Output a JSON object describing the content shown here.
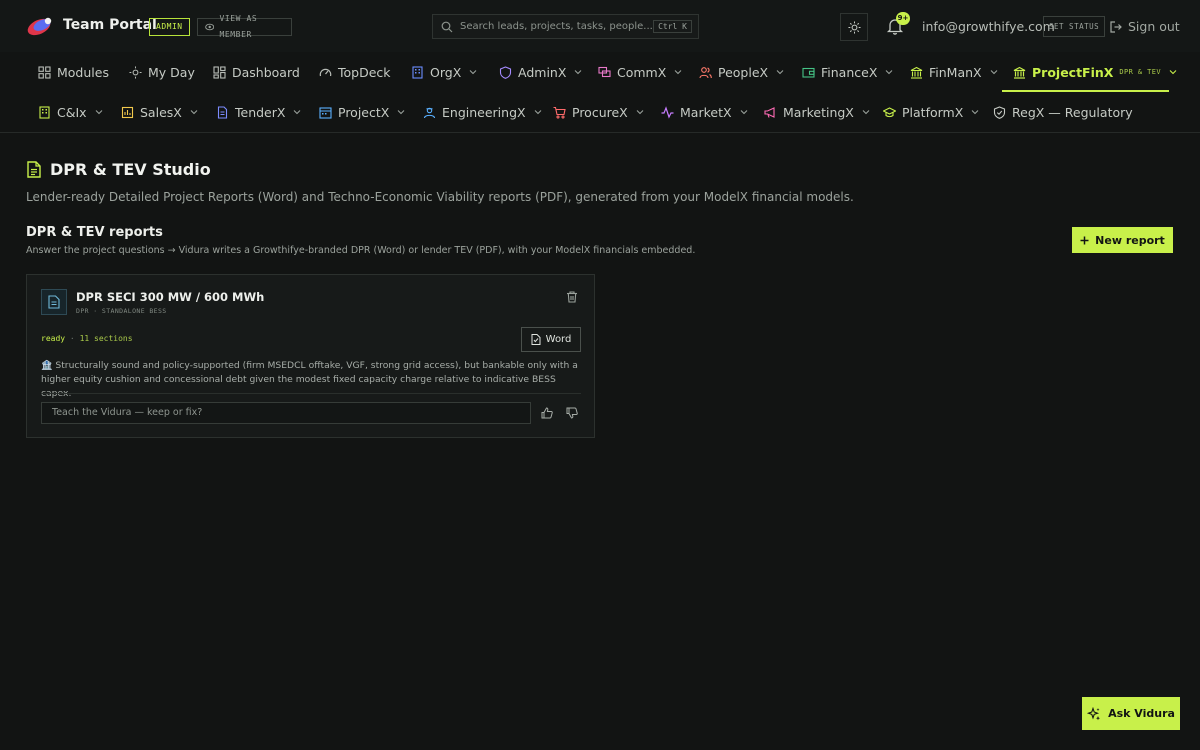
{
  "header": {
    "brand": "Team Portal",
    "admin_badge": "ADMIN",
    "view_member": "VIEW AS MEMBER",
    "search_placeholder": "Search leads, projects, tasks, people...",
    "search_shortcut": "Ctrl K",
    "notif_count": "9+",
    "email": "info@growthifye.com",
    "set_status": "SET STATUS",
    "signout": "Sign out"
  },
  "nav_row1": [
    {
      "label": "Modules",
      "icon": "grid-icon"
    },
    {
      "label": "My Day",
      "icon": "sun-icon"
    },
    {
      "label": "Dashboard",
      "icon": "dashboard-icon"
    },
    {
      "label": "TopDeck",
      "icon": "gauge-icon"
    },
    {
      "label": "OrgX",
      "icon": "building-icon"
    },
    {
      "label": "AdminX",
      "icon": "shield-icon"
    },
    {
      "label": "CommX",
      "icon": "chat-icon"
    },
    {
      "label": "PeopleX",
      "icon": "people-icon"
    },
    {
      "label": "FinanceX",
      "icon": "wallet-icon"
    },
    {
      "label": "FinManX",
      "icon": "bank-icon"
    },
    {
      "label": "ProjectFinX",
      "icon": "bank-icon",
      "sub": "DPR & TEV",
      "active": true
    }
  ],
  "nav_row2": [
    {
      "label": "C&Ix",
      "icon": "building-icon"
    },
    {
      "label": "SalesX",
      "icon": "sales-icon"
    },
    {
      "label": "TenderX",
      "icon": "tender-icon"
    },
    {
      "label": "ProjectX",
      "icon": "calendar-icon"
    },
    {
      "label": "EngineeringX",
      "icon": "engineer-icon"
    },
    {
      "label": "ProcureX",
      "icon": "cart-icon"
    },
    {
      "label": "MarketX",
      "icon": "pulse-icon"
    },
    {
      "label": "MarketingX",
      "icon": "megaphone-icon"
    },
    {
      "label": "PlatformX",
      "icon": "graduation-icon"
    },
    {
      "label": "RegX — Regulatory",
      "icon": "shield-check-icon"
    }
  ],
  "page": {
    "title": "DPR & TEV Studio",
    "subtitle": "Lender-ready Detailed Project Reports (Word) and Techno-Economic Viability reports (PDF), generated from your ModelX financial models.",
    "section_title": "DPR & TEV reports",
    "section_sub": "Answer the project questions → Vidura writes a Growthifye-branded DPR (Word) or lender TEV (PDF), with your ModelX financials embedded.",
    "new_report": "New report"
  },
  "report_card": {
    "title": "DPR SECI 300 MW / 600 MWh",
    "meta": "DPR · STANDALONE BESS",
    "status": "ready",
    "status_sep": "·",
    "sections": "11 sections",
    "word_button": "Word",
    "summary": "🏦 Structurally sound and policy-supported (firm MSEDCL offtake, VGF, strong grid access), but bankable only with a higher equity cushion and concessional debt given the modest fixed capacity charge relative to indicative BESS capex.",
    "feedback_placeholder": "Teach the Vidura — keep or fix?"
  },
  "ask_button": "Ask Vidura",
  "colors": {
    "accent": "#c8f04a",
    "background": "#121413",
    "card": "#171a19"
  }
}
